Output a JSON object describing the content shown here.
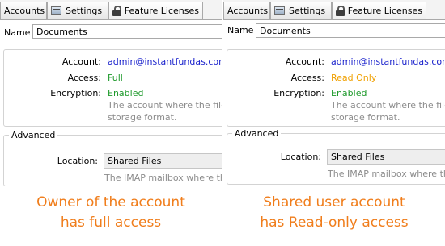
{
  "tabs": [
    "Accounts",
    "Settings",
    "Feature Licenses"
  ],
  "left": {
    "name_label": "Name",
    "name_value": "Documents",
    "account_label": "Account:",
    "account_value": "admin@instantfundas.com",
    "access_label": "Access:",
    "access_value": "Full",
    "encryption_label": "Encryption:",
    "encryption_value": "Enabled",
    "desc_line1": "The account where the files",
    "desc_line2": "storage format.",
    "advanced_label": "Advanced",
    "location_label": "Location:",
    "location_value": "Shared Files",
    "imap_desc": "The IMAP mailbox where the",
    "caption_line1": "Owner of the account",
    "caption_line2": "has full access"
  },
  "right": {
    "name_label": "Name",
    "name_value": "Documents",
    "account_label": "Account:",
    "account_value": "admin@instantfundas.com",
    "access_label": "Access:",
    "access_value": "Read Only",
    "encryption_label": "Encryption:",
    "encryption_value": "Enabled",
    "desc_line1": "The account where the files",
    "desc_line2": "storage format.",
    "advanced_label": "Advanced",
    "location_label": "Location:",
    "location_value": "Shared Files",
    "imap_desc": "The IMAP mailbox where the",
    "caption_line1": "Shared user account",
    "caption_line2": "has Read-only access"
  },
  "colors": {
    "link": "#1a22cc",
    "enabled": "#1f9a2c",
    "readonly": "#f0a000",
    "caption": "#f07d1b"
  },
  "icons": [
    "settings-icon",
    "lock-icon"
  ]
}
